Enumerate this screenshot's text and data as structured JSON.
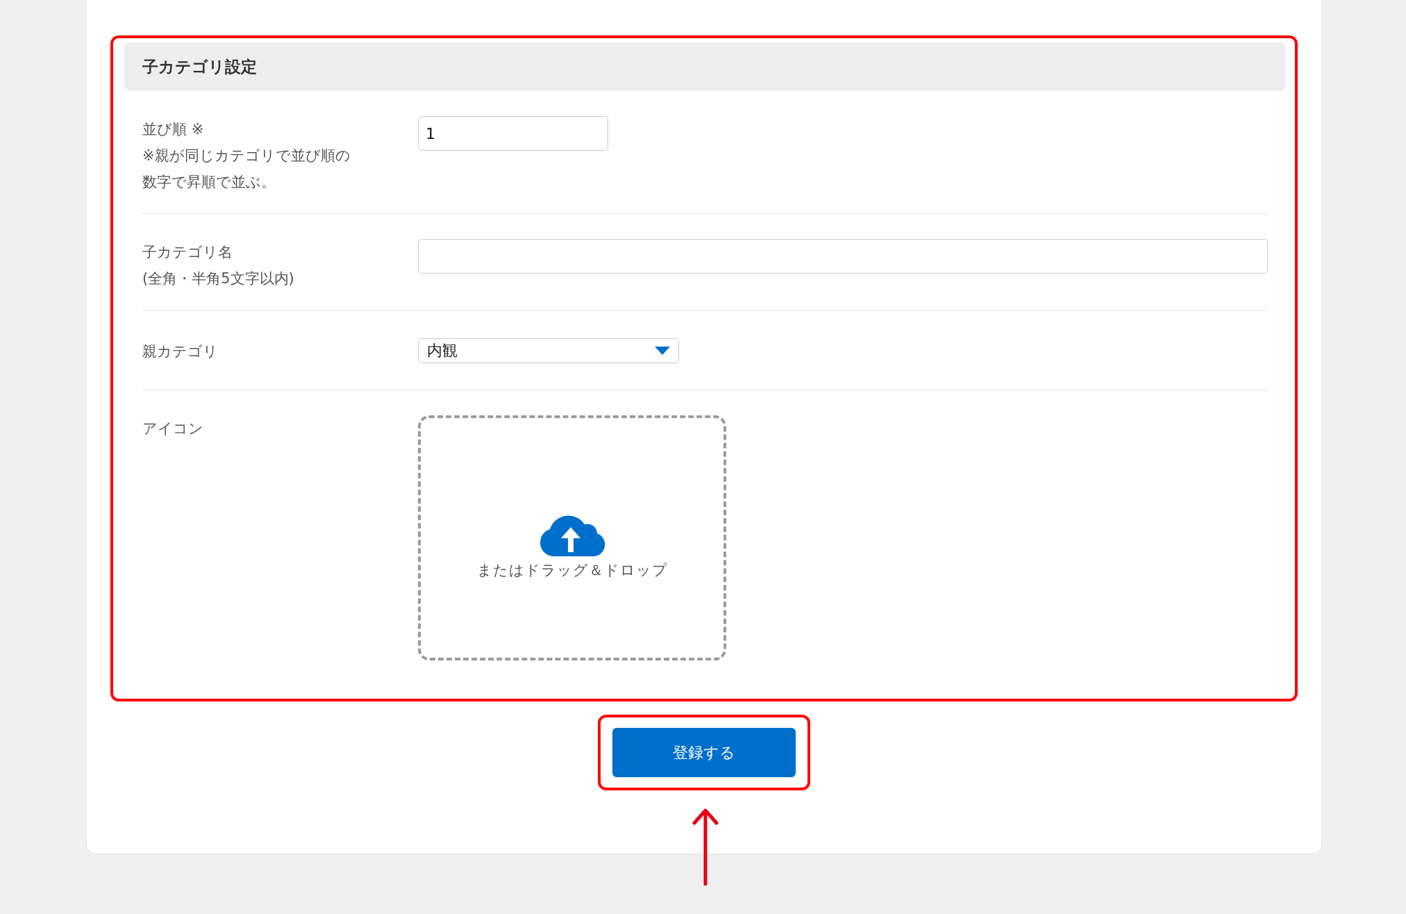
{
  "section": {
    "title": "子カテゴリ設定"
  },
  "fields": [
    {
      "kind": "text",
      "label_lines": [
        "並び順 ※",
        "※親が同じカテゴリで並び順の",
        "数字で昇順で並ぶ。"
      ],
      "value": "1"
    },
    {
      "kind": "wide_text",
      "label_lines": [
        "子カテゴリ名",
        "(全角・半角5文字以内)"
      ]
    },
    {
      "kind": "select",
      "label_lines": [
        "親カテゴリ"
      ],
      "value": "内観"
    },
    {
      "kind": "upload",
      "label_lines": [
        "アイコン"
      ],
      "hint": "またはドラッグ＆ドロップ"
    }
  ],
  "submit": {
    "label": "登録する"
  }
}
